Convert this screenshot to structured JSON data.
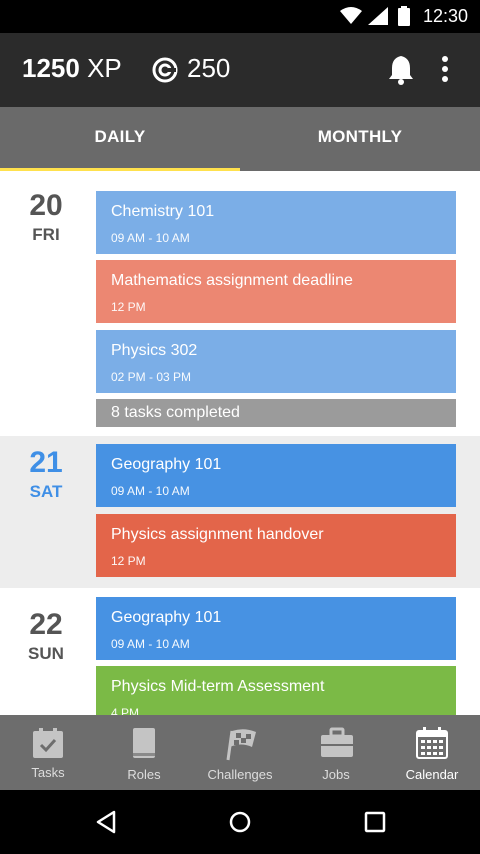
{
  "status_bar": {
    "time": "12:30",
    "icons": [
      "wifi-icon",
      "signal-icon",
      "battery-icon"
    ]
  },
  "header": {
    "xp_value": "1250",
    "xp_unit": " XP",
    "coins": "250",
    "icons": [
      "coin-icon",
      "bell-icon",
      "more-vert-icon"
    ]
  },
  "tabs": [
    {
      "label": "DAILY",
      "active": true
    },
    {
      "label": "MONTHLY",
      "active": false
    }
  ],
  "days": [
    {
      "num": "20",
      "dow": "FRI",
      "events": [
        {
          "title": "Chemistry 101",
          "time": "09 AM - 10 AM",
          "color": "#7baee7"
        },
        {
          "title": "Mathematics assignment deadline",
          "time": "12 PM",
          "color": "#ec8772"
        },
        {
          "title": "Physics 302",
          "time": "02 PM - 03 PM",
          "color": "#7baee7"
        }
      ],
      "summary": "8 tasks completed"
    },
    {
      "num": "21",
      "dow": "SAT",
      "today": true,
      "events": [
        {
          "title": "Geography 101",
          "time": "09 AM - 10 AM",
          "color": "#4792e3"
        },
        {
          "title": "Physics assignment handover",
          "time": "12 PM",
          "color": "#e3654a"
        }
      ]
    },
    {
      "num": "22",
      "dow": "SUN",
      "events": [
        {
          "title": "Geography 101",
          "time": "09 AM - 10 AM",
          "color": "#4792e3"
        },
        {
          "title": "Physics Mid-term Assessment",
          "time": "4 PM",
          "color": "#7bba46"
        }
      ]
    }
  ],
  "bottom_nav": [
    {
      "label": "Tasks",
      "icon": "tasks-icon"
    },
    {
      "label": "Roles",
      "icon": "book-icon"
    },
    {
      "label": "Challenges",
      "icon": "flag-icon"
    },
    {
      "label": "Jobs",
      "icon": "briefcase-icon"
    },
    {
      "label": "Calendar",
      "icon": "calendar-icon",
      "active": true
    }
  ],
  "colors": {
    "accent": "#ffe14d",
    "today": "#3f8fe6",
    "appbar": "#2b2b2b",
    "tabbar": "#6a6a6a"
  }
}
